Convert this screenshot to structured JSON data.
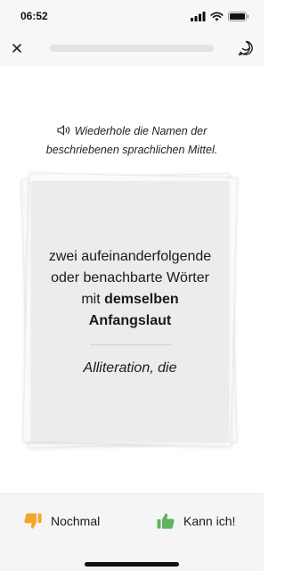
{
  "status_bar": {
    "time": "06:52",
    "icons": [
      "signal-icon",
      "wifi-icon",
      "battery-icon"
    ]
  },
  "nav": {
    "close_icon": "close-icon",
    "progress": 0,
    "chat_icon": "chat-icon"
  },
  "instruction": {
    "icon": "speaker-icon",
    "text": "Wiederhole die Namen der beschriebenen sprachlichen Mittel."
  },
  "card": {
    "prompt_line1": "zwei aufeinanderfolgende",
    "prompt_line2": "oder benachbarte Wörter",
    "prompt_line3_plain": "mit ",
    "prompt_line3_bold": "demselben",
    "prompt_line4_bold": "Anfangslaut",
    "answer": "Alliteration, die"
  },
  "actions": {
    "again_label": "Nochmal",
    "again_icon": "thumbs-down-icon",
    "again_color": "#F4A62A",
    "know_label": "Kann ich!",
    "know_icon": "thumbs-up-icon",
    "know_color": "#5FB55D"
  }
}
